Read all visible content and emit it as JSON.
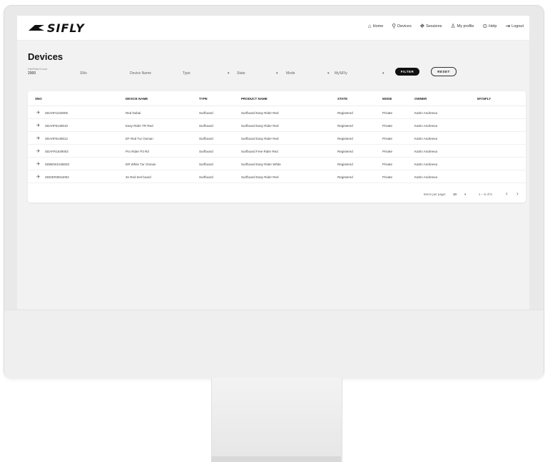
{
  "app": {
    "brand": "SIFLY"
  },
  "nav": [
    {
      "icon": "home-icon",
      "glyph": "⌂",
      "label": "Home"
    },
    {
      "icon": "devices-icon",
      "glyph": "⚲",
      "label": "Devices"
    },
    {
      "icon": "sessions-icon",
      "glyph": "⛖",
      "label": "Sessions"
    },
    {
      "icon": "user-icon",
      "glyph": "♙",
      "label": "My profile"
    },
    {
      "icon": "help-icon",
      "glyph": "⊙",
      "label": "Help"
    },
    {
      "icon": "logout-icon",
      "glyph": "⇥",
      "label": "Logout"
    }
  ],
  "page": {
    "title": "Devices"
  },
  "filters": {
    "caption": "KiteRiderCount",
    "count": "2000",
    "sno": "SNo",
    "device_name": "Device Name",
    "type": "Type",
    "state": "State",
    "mode": "Mode",
    "mysifly": "MySiFly",
    "filter_btn": "FILTER",
    "reset_btn": "RESET"
  },
  "table": {
    "headers": {
      "sno": "SNO",
      "device_name": "DEVICE NAME",
      "type": "TYPE",
      "product_name": "PRODUCT NAME",
      "state": "STATE",
      "mode": "MODE",
      "owner": "OWNER",
      "mysifly": "MYSIFLY"
    },
    "rows": [
      {
        "sno": "SDA0F1043005",
        "device_name": "Red Dubai",
        "type": "Surfboard",
        "product_name": "Surfboard Easy Rider Red",
        "state": "Registered",
        "mode": "Private",
        "owner": "Katrin Andreeva",
        "mysifly": ""
      },
      {
        "sno": "SDA0F9149010",
        "device_name": "Easy Rider TR Red",
        "type": "Surfboard",
        "product_name": "Surfboard Easy Rider Red",
        "state": "Registered",
        "mode": "Private",
        "owner": "Katrin Andreeva",
        "mysifly": ""
      },
      {
        "sno": "SDA0F9149012",
        "device_name": "EF Red Tur Osman",
        "type": "Surfboard",
        "product_name": "Surfboard Easy Rider Red",
        "state": "Registered",
        "mode": "Private",
        "owner": "Katrin Andreeva",
        "mysifly": ""
      },
      {
        "sno": "SDAFR1549003",
        "device_name": "Pro Rider P3 Rd",
        "type": "Surfboard",
        "product_name": "Surfboard Free Rider Red",
        "state": "Registered",
        "mode": "Private",
        "owner": "Katrin Andreeva",
        "mysifly": ""
      },
      {
        "sno": "SDBEW1048003",
        "device_name": "ER White Tur Osman",
        "type": "Surfboard",
        "product_name": "Surfboard Easy Rider White",
        "state": "Registered",
        "mode": "Private",
        "owner": "Katrin Andreeva",
        "mysifly": ""
      },
      {
        "sno": "SDDER3E54002",
        "device_name": "3n Red test board",
        "type": "Surfboard",
        "product_name": "Surfboard Easy Rider Red",
        "state": "Registered",
        "mode": "Private",
        "owner": "Katrin Andreeva",
        "mysifly": ""
      }
    ]
  },
  "pagination": {
    "items_label": "Items per page:",
    "per_page": "10",
    "range": "1 – 6 of 6",
    "prev": "‹",
    "next": "›"
  }
}
